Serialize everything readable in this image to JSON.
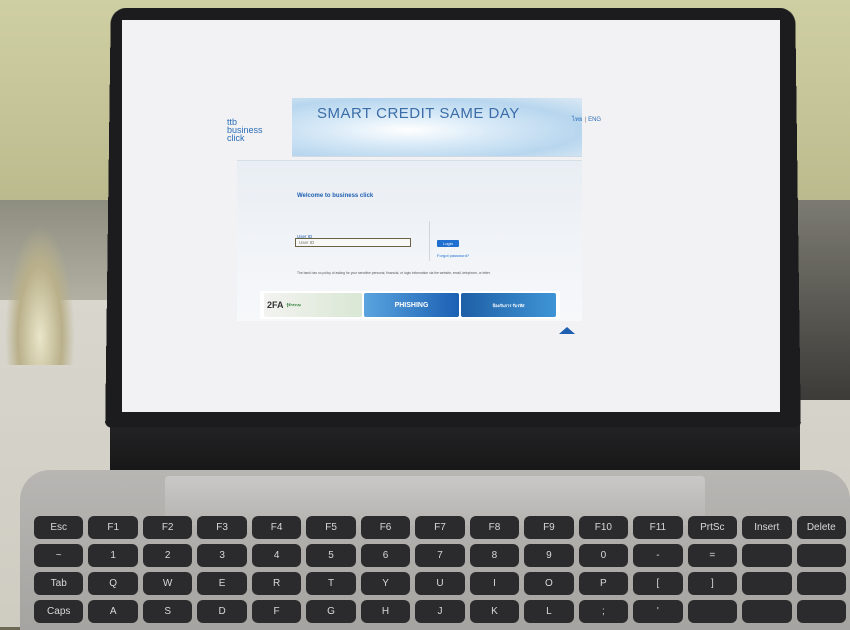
{
  "header": {
    "brand_line1": "ttb",
    "brand_line2": "business",
    "brand_line3": "click",
    "banner_text": "SMART CREDIT SAME DAY",
    "lang_thai": "ไทย",
    "lang_sep": "|",
    "lang_eng": "ENG"
  },
  "login": {
    "welcome": "Welcome to business click",
    "userid_label": "User ID",
    "userid_placeholder": "User ID",
    "login_button": "Login",
    "forgot_password": "Forgot password?",
    "notice": "The bank has no policy of asking for your sensitive personal, financial, or login information via the website, email, telephone, or letter."
  },
  "promos": {
    "item1_tag": "2FA",
    "item1_sub": "รู้จักระบบ",
    "item2_label": "PHISHING",
    "item3_label": "ป้องกันการ รับรหัส"
  },
  "keyboard": {
    "keys": [
      "Esc",
      "F1",
      "F2",
      "F3",
      "F4",
      "F5",
      "F6",
      "F7",
      "F8",
      "F9",
      "F10",
      "F11",
      "PrtSc",
      "Insert",
      "Delete",
      "~",
      "1",
      "2",
      "3",
      "4",
      "5",
      "6",
      "7",
      "8",
      "9",
      "0",
      "-",
      "=",
      "",
      "",
      "Tab",
      "Q",
      "W",
      "E",
      "R",
      "T",
      "Y",
      "U",
      "I",
      "O",
      "P",
      "[",
      "]",
      "",
      "",
      "Caps",
      "A",
      "S",
      "D",
      "F",
      "G",
      "H",
      "J",
      "K",
      "L",
      ";",
      "'",
      "",
      "",
      ""
    ]
  },
  "colors": {
    "link_blue": "#1f5fb0",
    "button_blue": "#1f6fd0",
    "bezel": "#1c1c1e"
  }
}
